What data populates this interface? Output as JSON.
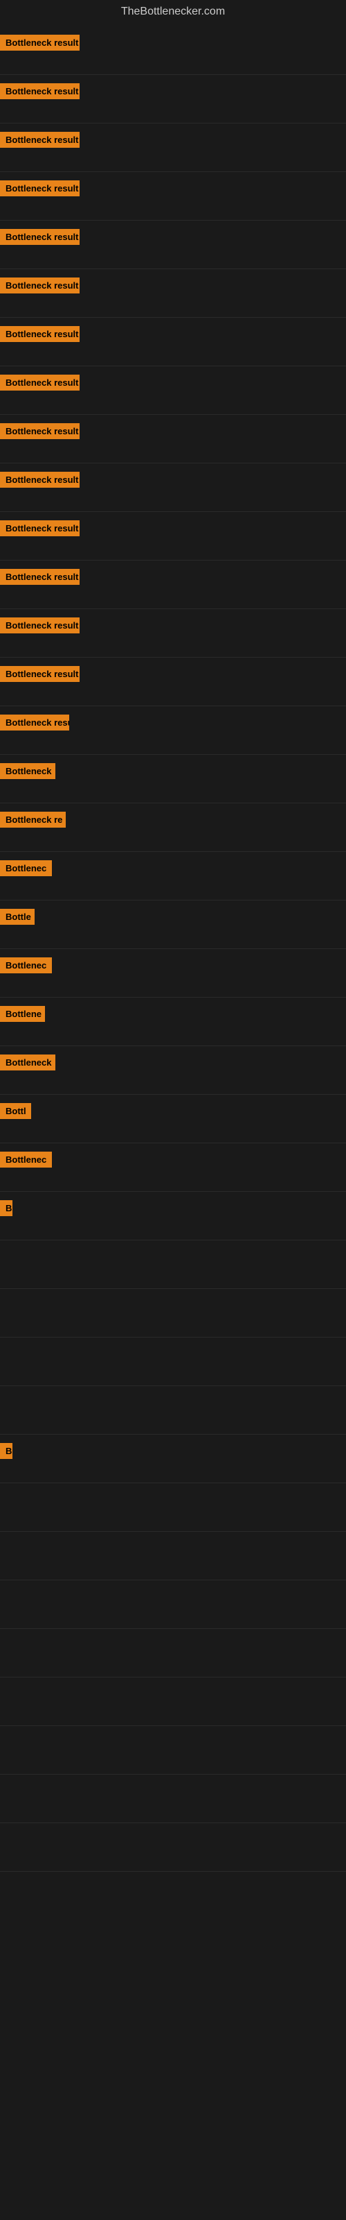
{
  "header": {
    "title": "TheBottlenecker.com"
  },
  "items": [
    {
      "badge": "Bottleneck result",
      "width": 115
    },
    {
      "badge": "Bottleneck result",
      "width": 115
    },
    {
      "badge": "Bottleneck result",
      "width": 115
    },
    {
      "badge": "Bottleneck result",
      "width": 115
    },
    {
      "badge": "Bottleneck result",
      "width": 115
    },
    {
      "badge": "Bottleneck result",
      "width": 115
    },
    {
      "badge": "Bottleneck result",
      "width": 115
    },
    {
      "badge": "Bottleneck result",
      "width": 115
    },
    {
      "badge": "Bottleneck result",
      "width": 115
    },
    {
      "badge": "Bottleneck result",
      "width": 115
    },
    {
      "badge": "Bottleneck result",
      "width": 115
    },
    {
      "badge": "Bottleneck result",
      "width": 115
    },
    {
      "badge": "Bottleneck result",
      "width": 115
    },
    {
      "badge": "Bottleneck result",
      "width": 115
    },
    {
      "badge": "Bottleneck resu",
      "width": 100
    },
    {
      "badge": "Bottleneck",
      "width": 80
    },
    {
      "badge": "Bottleneck re",
      "width": 95
    },
    {
      "badge": "Bottlenec",
      "width": 75
    },
    {
      "badge": "Bottle",
      "width": 50
    },
    {
      "badge": "Bottlenec",
      "width": 75
    },
    {
      "badge": "Bottlene",
      "width": 65
    },
    {
      "badge": "Bottleneck",
      "width": 80
    },
    {
      "badge": "Bottl",
      "width": 45
    },
    {
      "badge": "Bottlenec",
      "width": 75
    },
    {
      "badge": "B",
      "width": 18
    },
    {
      "badge": "",
      "width": 0
    },
    {
      "badge": "",
      "width": 0
    },
    {
      "badge": "",
      "width": 0
    },
    {
      "badge": "",
      "width": 0
    },
    {
      "badge": "B",
      "width": 18
    },
    {
      "badge": "",
      "width": 0
    },
    {
      "badge": "",
      "width": 0
    },
    {
      "badge": "",
      "width": 0
    },
    {
      "badge": "",
      "width": 0
    },
    {
      "badge": "",
      "width": 0
    },
    {
      "badge": "",
      "width": 0
    },
    {
      "badge": "",
      "width": 0
    },
    {
      "badge": "",
      "width": 0
    }
  ]
}
